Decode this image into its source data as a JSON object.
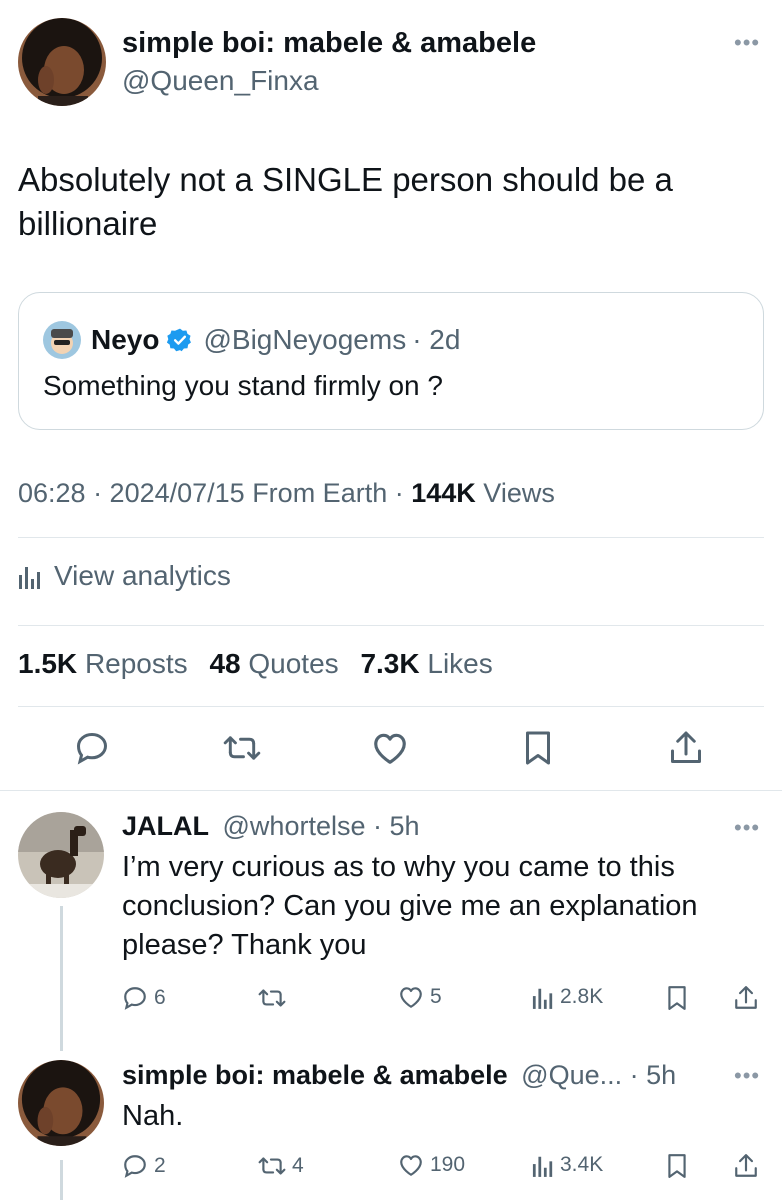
{
  "tweet": {
    "author_name": "simple boi: mabele & amabele",
    "author_handle": "@Queen_Finxa",
    "more_icon": "more-icon",
    "text": "Absolutely not a SINGLE person should be a billionaire",
    "quote": {
      "name": "Neyo",
      "handle": "@BigNeyogems",
      "time": "· 2d",
      "text": "Something you stand firmly on ?",
      "verified_color": "#1d9bf0"
    },
    "meta": {
      "timestamp": "06:28 · 2024/07/15 From Earth ·",
      "views_count": "144K",
      "views_label": "Views"
    },
    "analytics_label": "View analytics",
    "stats": {
      "reposts_count": "1.5K",
      "reposts_label": "Reposts",
      "quotes_count": "48",
      "quotes_label": "Quotes",
      "likes_count": "7.3K",
      "likes_label": "Likes"
    }
  },
  "replies": [
    {
      "name": "JALAL",
      "handle": "@whortelse",
      "time": "· 5h",
      "text": "I’m very curious as to why you came to this conclusion? Can you give me an explanation please? Thank you",
      "replies": "6",
      "reposts": "",
      "likes": "5",
      "views": "2.8K"
    },
    {
      "name": "simple boi: mabele & amabele",
      "handle": "@Que... · 5h",
      "time": "",
      "text": "Nah.",
      "replies": "2",
      "reposts": "4",
      "likes": "190",
      "views": "3.4K"
    }
  ],
  "colors": {
    "text": "#0f1419",
    "secondary": "#536471",
    "border": "#cfd9de",
    "accent": "#1d9bf0"
  }
}
